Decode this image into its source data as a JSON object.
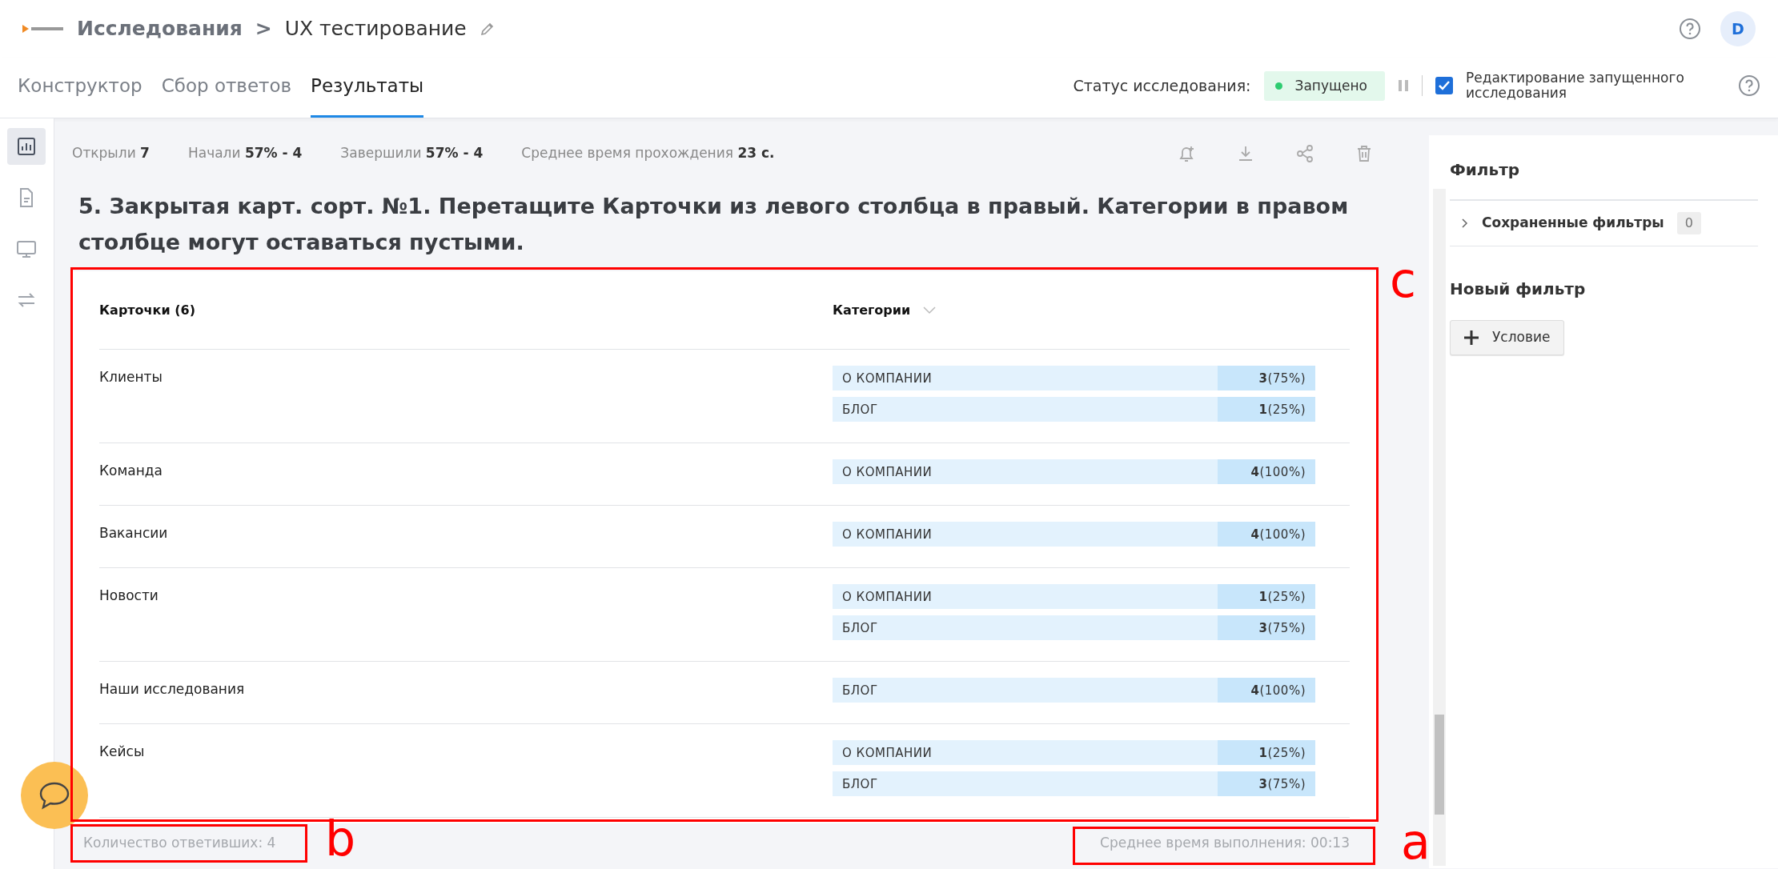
{
  "header": {
    "breadcrumb": "Исследования",
    "separator": ">",
    "title": "UX тестирование",
    "avatar": "D"
  },
  "tabs": [
    {
      "label": "Конструктор",
      "selected": false
    },
    {
      "label": "Сбор ответов",
      "selected": false
    },
    {
      "label": "Результаты",
      "selected": true
    }
  ],
  "status": {
    "label": "Статус исследования:",
    "state": "Запущено",
    "edit_running": {
      "label": "Редактирование запущенного исследования",
      "checked": true
    }
  },
  "sidebar": {
    "items": [
      {
        "kind": "chart",
        "selected": true
      },
      {
        "kind": "document",
        "selected": false
      },
      {
        "kind": "monitor",
        "selected": false
      },
      {
        "kind": "swap",
        "selected": false
      }
    ]
  },
  "stats": [
    {
      "label": "Открыли",
      "value": "7"
    },
    {
      "label": "Начали",
      "value": "57% - 4"
    },
    {
      "label": "Завершили",
      "value": "57% - 4"
    },
    {
      "label": "Среднее время прохождения",
      "value": "23 с."
    }
  ],
  "question": {
    "title": "5. Закрытая карт. сорт. №1. Перетащите Карточки из левого столбца в правый. Категории в правом столбце могут оставаться пустыми."
  },
  "table": {
    "columns": [
      "Карточки (6)",
      "Категории"
    ],
    "rows": [
      {
        "card": "Клиенты",
        "categories": [
          {
            "name": "О КОМПАНИИ",
            "result": "**3**(75%)"
          },
          {
            "name": "БЛОГ",
            "result": "**1**(25%)"
          }
        ]
      },
      {
        "card": "Команда",
        "categories": [
          {
            "name": "О КОМПАНИИ",
            "result": "**4**(100%)"
          }
        ]
      },
      {
        "card": "Вакансии",
        "categories": [
          {
            "name": "О КОМПАНИИ",
            "result": "**4**(100%)"
          }
        ]
      },
      {
        "card": "Новости",
        "categories": [
          {
            "name": "О КОМПАНИИ",
            "result": "**1**(25%)"
          },
          {
            "name": "БЛОГ",
            "result": "**3**(75%)"
          }
        ]
      },
      {
        "card": "Наши исследования",
        "categories": [
          {
            "name": "БЛОГ",
            "result": "**4**(100%)"
          }
        ]
      },
      {
        "card": "Кейсы",
        "categories": [
          {
            "name": "О КОМПАНИИ",
            "result": "**1**(25%)"
          },
          {
            "name": "БЛОГ",
            "result": "**3**(75%)"
          }
        ]
      }
    ]
  },
  "footer": {
    "respondents": "Количество ответивших: 4",
    "avg_time": "Среднее время выполнения: 00:13"
  },
  "filter": {
    "title": "Фильтр",
    "saved": {
      "label": "Сохраненные фильтры",
      "count": "0"
    },
    "new_title": "Новый фильтр",
    "add_button": "Условие"
  },
  "annotations": [
    {
      "label": "c"
    },
    {
      "label": "b"
    },
    {
      "label": "a"
    }
  ]
}
